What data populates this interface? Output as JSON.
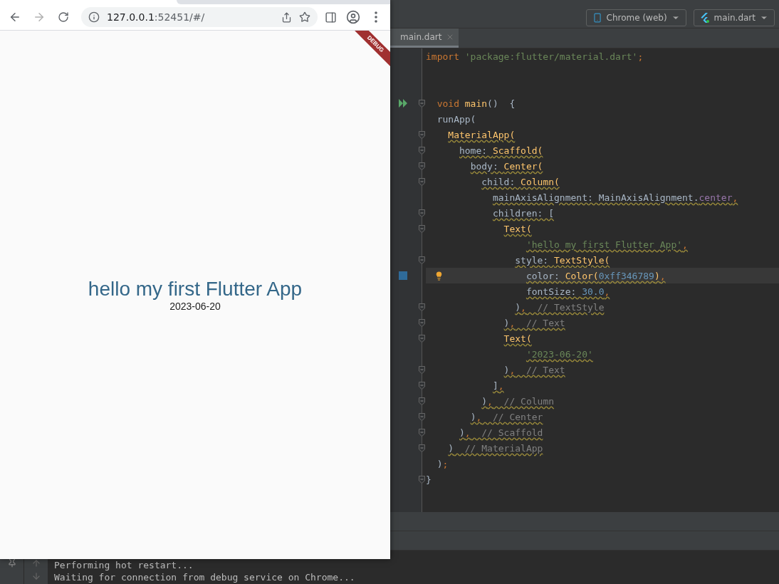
{
  "ide": {
    "run_config": [
      {
        "kind": "device",
        "label": "Chrome (web)"
      },
      {
        "kind": "flutter",
        "label": "main.dart"
      }
    ],
    "tabs": [
      {
        "label": "main.dart",
        "selected": true
      }
    ],
    "code_lines": [
      {
        "tokens": [
          {
            "text": "import ",
            "kind": "keyword"
          },
          {
            "text": "'package:flutter/material.dart'",
            "kind": "string"
          },
          {
            "text": ";",
            "kind": "keyword"
          }
        ],
        "fold": false,
        "current": false,
        "warning": false
      },
      {
        "fold": false,
        "current": false
      },
      {
        "fold": false,
        "current": false
      },
      {
        "tokens": [
          {
            "text": "  void ",
            "kind": "keyword"
          },
          {
            "text": "main",
            "kind": "function"
          },
          {
            "text": "()  {",
            "kind": "plain"
          }
        ],
        "fold": true,
        "current": false,
        "warning": false,
        "gutter": {
          "kind": "run"
        }
      },
      {
        "tokens": [
          {
            "text": "  runApp(",
            "kind": "plain"
          }
        ],
        "fold": false,
        "current": false,
        "warning": false
      },
      {
        "tokens": [
          {
            "text": "    MaterialApp(",
            "kind": "class"
          }
        ],
        "fold": true,
        "current": false,
        "warning": true
      },
      {
        "tokens": [
          {
            "text": "      home: ",
            "kind": "plain"
          },
          {
            "text": "Scaffold(",
            "kind": "class"
          }
        ],
        "fold": true,
        "current": false,
        "warning": true
      },
      {
        "tokens": [
          {
            "text": "        body: ",
            "kind": "plain"
          },
          {
            "text": "Center(",
            "kind": "class"
          }
        ],
        "fold": true,
        "current": false,
        "warning": true
      },
      {
        "tokens": [
          {
            "text": "          child: ",
            "kind": "plain"
          },
          {
            "text": "Column(",
            "kind": "class"
          }
        ],
        "fold": true,
        "current": false,
        "warning": true
      },
      {
        "tokens": [
          {
            "text": "            mainAxisAlignment: MainAxisAlignment.",
            "kind": "plain"
          },
          {
            "text": "center",
            "kind": "field"
          },
          {
            "text": ",",
            "kind": "keyword"
          }
        ],
        "fold": false,
        "current": false,
        "warning": true
      },
      {
        "tokens": [
          {
            "text": "            children: [",
            "kind": "plain"
          }
        ],
        "fold": true,
        "current": false,
        "warning": true
      },
      {
        "tokens": [
          {
            "text": "              Text(",
            "kind": "class"
          }
        ],
        "fold": true,
        "current": false,
        "warning": true
      },
      {
        "tokens": [
          {
            "text": "                  'hello my first Flutter App'",
            "kind": "string"
          },
          {
            "text": ",",
            "kind": "keyword"
          }
        ],
        "fold": false,
        "current": false,
        "warning": true
      },
      {
        "tokens": [
          {
            "text": "                style: ",
            "kind": "plain"
          },
          {
            "text": "TextStyle(",
            "kind": "class"
          }
        ],
        "fold": true,
        "current": false,
        "warning": true
      },
      {
        "tokens": [
          {
            "text": "                  color: ",
            "kind": "plain"
          },
          {
            "text": "Color(",
            "kind": "class"
          },
          {
            "text": "0xff346789",
            "kind": "number"
          },
          {
            "text": ")",
            "kind": "class"
          },
          {
            "text": ",",
            "kind": "keyword"
          }
        ],
        "fold": false,
        "current": true,
        "warning": true,
        "gutter": {
          "kind": "swatch",
          "color": "#2f6b99"
        },
        "bulb": true
      },
      {
        "tokens": [
          {
            "text": "                  fontSize: ",
            "kind": "plain"
          },
          {
            "text": "30.0",
            "kind": "number"
          },
          {
            "text": ",",
            "kind": "keyword"
          }
        ],
        "fold": false,
        "current": false,
        "warning": true
      },
      {
        "tokens": [
          {
            "text": "                )",
            "kind": "plain"
          },
          {
            "text": ",",
            "kind": "keyword"
          },
          {
            "text": "  // TextStyle",
            "kind": "comment"
          }
        ],
        "fold": true,
        "current": false,
        "warning": true
      },
      {
        "tokens": [
          {
            "text": "              )",
            "kind": "plain"
          },
          {
            "text": ",",
            "kind": "keyword"
          },
          {
            "text": "  // Text",
            "kind": "comment"
          }
        ],
        "fold": true,
        "current": false,
        "warning": true
      },
      {
        "tokens": [
          {
            "text": "              Text(",
            "kind": "class"
          }
        ],
        "fold": true,
        "current": false,
        "warning": true
      },
      {
        "tokens": [
          {
            "text": "                  '2023-06-20'",
            "kind": "string"
          }
        ],
        "fold": false,
        "current": false,
        "warning": true
      },
      {
        "tokens": [
          {
            "text": "              )",
            "kind": "plain"
          },
          {
            "text": ",",
            "kind": "keyword"
          },
          {
            "text": "  // Text",
            "kind": "comment"
          }
        ],
        "fold": true,
        "current": false,
        "warning": true
      },
      {
        "tokens": [
          {
            "text": "            ]",
            "kind": "plain"
          },
          {
            "text": ",",
            "kind": "keyword"
          }
        ],
        "fold": true,
        "current": false,
        "warning": true
      },
      {
        "tokens": [
          {
            "text": "          )",
            "kind": "plain"
          },
          {
            "text": ",",
            "kind": "keyword"
          },
          {
            "text": "  // Column",
            "kind": "comment"
          }
        ],
        "fold": true,
        "current": false,
        "warning": true
      },
      {
        "tokens": [
          {
            "text": "        )",
            "kind": "plain"
          },
          {
            "text": ",",
            "kind": "keyword"
          },
          {
            "text": "  // Center",
            "kind": "comment"
          }
        ],
        "fold": true,
        "current": false,
        "warning": true
      },
      {
        "tokens": [
          {
            "text": "      )",
            "kind": "plain"
          },
          {
            "text": ",",
            "kind": "keyword"
          },
          {
            "text": "  // Scaffold",
            "kind": "comment"
          }
        ],
        "fold": true,
        "current": false,
        "warning": true
      },
      {
        "tokens": [
          {
            "text": "    )",
            "kind": "plain"
          },
          {
            "text": "  // MaterialApp",
            "kind": "comment"
          }
        ],
        "fold": true,
        "current": false,
        "warning": true
      },
      {
        "tokens": [
          {
            "text": "  )",
            "kind": "plain"
          },
          {
            "text": ";",
            "kind": "keyword"
          }
        ],
        "fold": false,
        "current": false,
        "warning": false
      },
      {
        "tokens": [
          {
            "text": "}",
            "kind": "plain"
          }
        ],
        "fold": true,
        "current": false,
        "warning": false
      },
      {
        "fold": false,
        "current": false
      }
    ],
    "console": [
      "Performing hot restart...",
      "Waiting for connection from debug service on Chrome..."
    ]
  },
  "browser": {
    "nav_buttons": [
      {
        "kind": "back",
        "disabled": false
      },
      {
        "kind": "forward",
        "disabled": true
      },
      {
        "kind": "reload",
        "disabled": false
      }
    ],
    "url_host": "127.0.0.1",
    "url_rest": ":52451/#/",
    "banner": "DEBUG",
    "app": {
      "title": "hello my first Flutter App",
      "date": "2023-06-20"
    }
  }
}
